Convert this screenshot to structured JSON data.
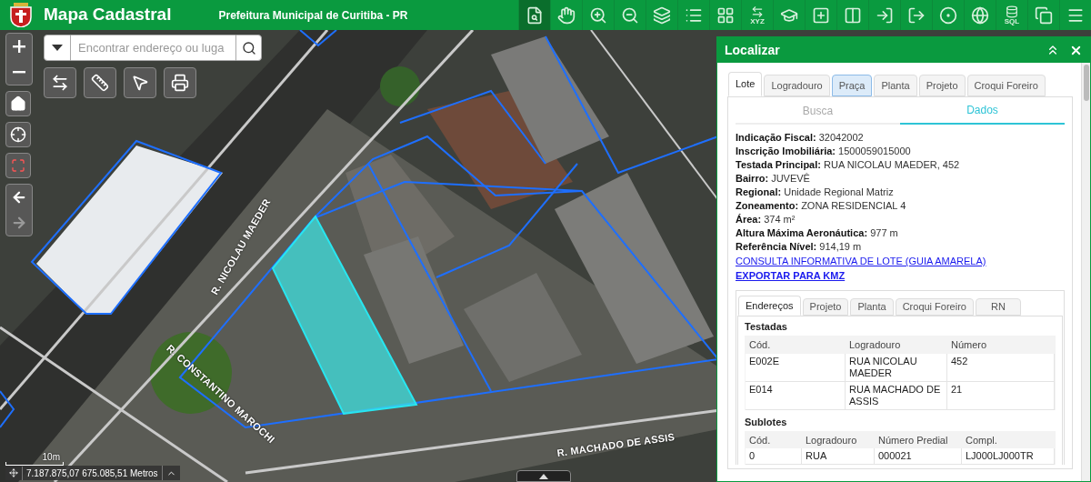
{
  "header": {
    "title": "Mapa Cadastral",
    "subtitle": "Prefeitura Municipal de Curitiba - PR"
  },
  "toolbar": [
    {
      "selected": true
    },
    {
      "selected": false
    },
    {
      "selected": false
    },
    {
      "selected": false
    },
    {
      "selected": false
    },
    {
      "selected": false
    },
    {
      "selected": false
    },
    {
      "selected": false,
      "label": "XYZ"
    },
    {
      "selected": false
    },
    {
      "selected": false
    },
    {
      "selected": false
    },
    {
      "selected": false
    },
    {
      "selected": false
    },
    {
      "selected": false
    },
    {
      "selected": false
    },
    {
      "selected": false,
      "label": "SQL"
    },
    {
      "selected": false
    },
    {
      "selected": false
    }
  ],
  "search": {
    "placeholder": "Encontrar endereço ou luga"
  },
  "map": {
    "street_labels": [
      "R. NICOLAU MAEDER",
      "R. CONSTANTINO MAROCHI",
      "R. MACHADO DE ASSIS"
    ],
    "scale": "10m",
    "coordinates": "7.187.875,07 675.085,51 Metros"
  },
  "panel": {
    "title": "Localizar",
    "tabs": [
      {
        "label": "Lote",
        "selected": true,
        "highlighted": false
      },
      {
        "label": "Logradouro",
        "selected": false,
        "highlighted": false
      },
      {
        "label": "Praça",
        "selected": false,
        "highlighted": true
      },
      {
        "label": "Planta",
        "selected": false,
        "highlighted": false
      },
      {
        "label": "Projeto",
        "selected": false,
        "highlighted": false
      },
      {
        "label": "Croqui Foreiro",
        "selected": false,
        "highlighted": false
      }
    ],
    "subtabs": [
      {
        "label": "Busca",
        "selected": false
      },
      {
        "label": "Dados",
        "selected": true
      }
    ],
    "fields": [
      {
        "label": "Indicação Fiscal:",
        "value": "32042002"
      },
      {
        "label": "Inscrição Imobiliária:",
        "value": "1500059015000"
      },
      {
        "label": "Testada Principal:",
        "value": "RUA NICOLAU MAEDER, 452"
      },
      {
        "label": "Bairro:",
        "value": "JUVEVÊ"
      },
      {
        "label": "Regional:",
        "value": "Unidade Regional Matriz"
      },
      {
        "label": "Zoneamento:",
        "value": "ZONA RESIDENCIAL 4"
      },
      {
        "label": "Área:",
        "value": "374 m²"
      },
      {
        "label": "Altura Máxima Aeronáutica:",
        "value": "977 m"
      },
      {
        "label": "Referência Nível:",
        "value": "914,19 m"
      }
    ],
    "links": [
      {
        "text": "CONSULTA INFORMATIVA DE LOTE (GUIA AMARELA)",
        "bold": false
      },
      {
        "text": "EXPORTAR PARA KMZ",
        "bold": true
      }
    ],
    "inner_tabs": [
      {
        "label": "Endereços",
        "selected": true
      },
      {
        "label": "Projeto",
        "selected": false
      },
      {
        "label": "Planta",
        "selected": false
      },
      {
        "label": "Croqui Foreiro",
        "selected": false
      },
      {
        "label": "RN",
        "selected": false
      }
    ],
    "testadas": {
      "title": "Testadas",
      "columns": [
        "Cód.",
        "Logradouro",
        "Número"
      ],
      "rows": [
        [
          "E002E",
          "RUA NICOLAU MAEDER",
          "452"
        ],
        [
          "E014",
          "RUA MACHADO DE ASSIS",
          "21"
        ]
      ]
    },
    "sublotes": {
      "title": "Sublotes",
      "columns": [
        "Cód.",
        "Logradouro",
        "Número Predial",
        "Compl."
      ],
      "rows": [
        [
          "0",
          "RUA",
          "000021",
          "LJ000LJ000TR"
        ]
      ]
    }
  }
}
